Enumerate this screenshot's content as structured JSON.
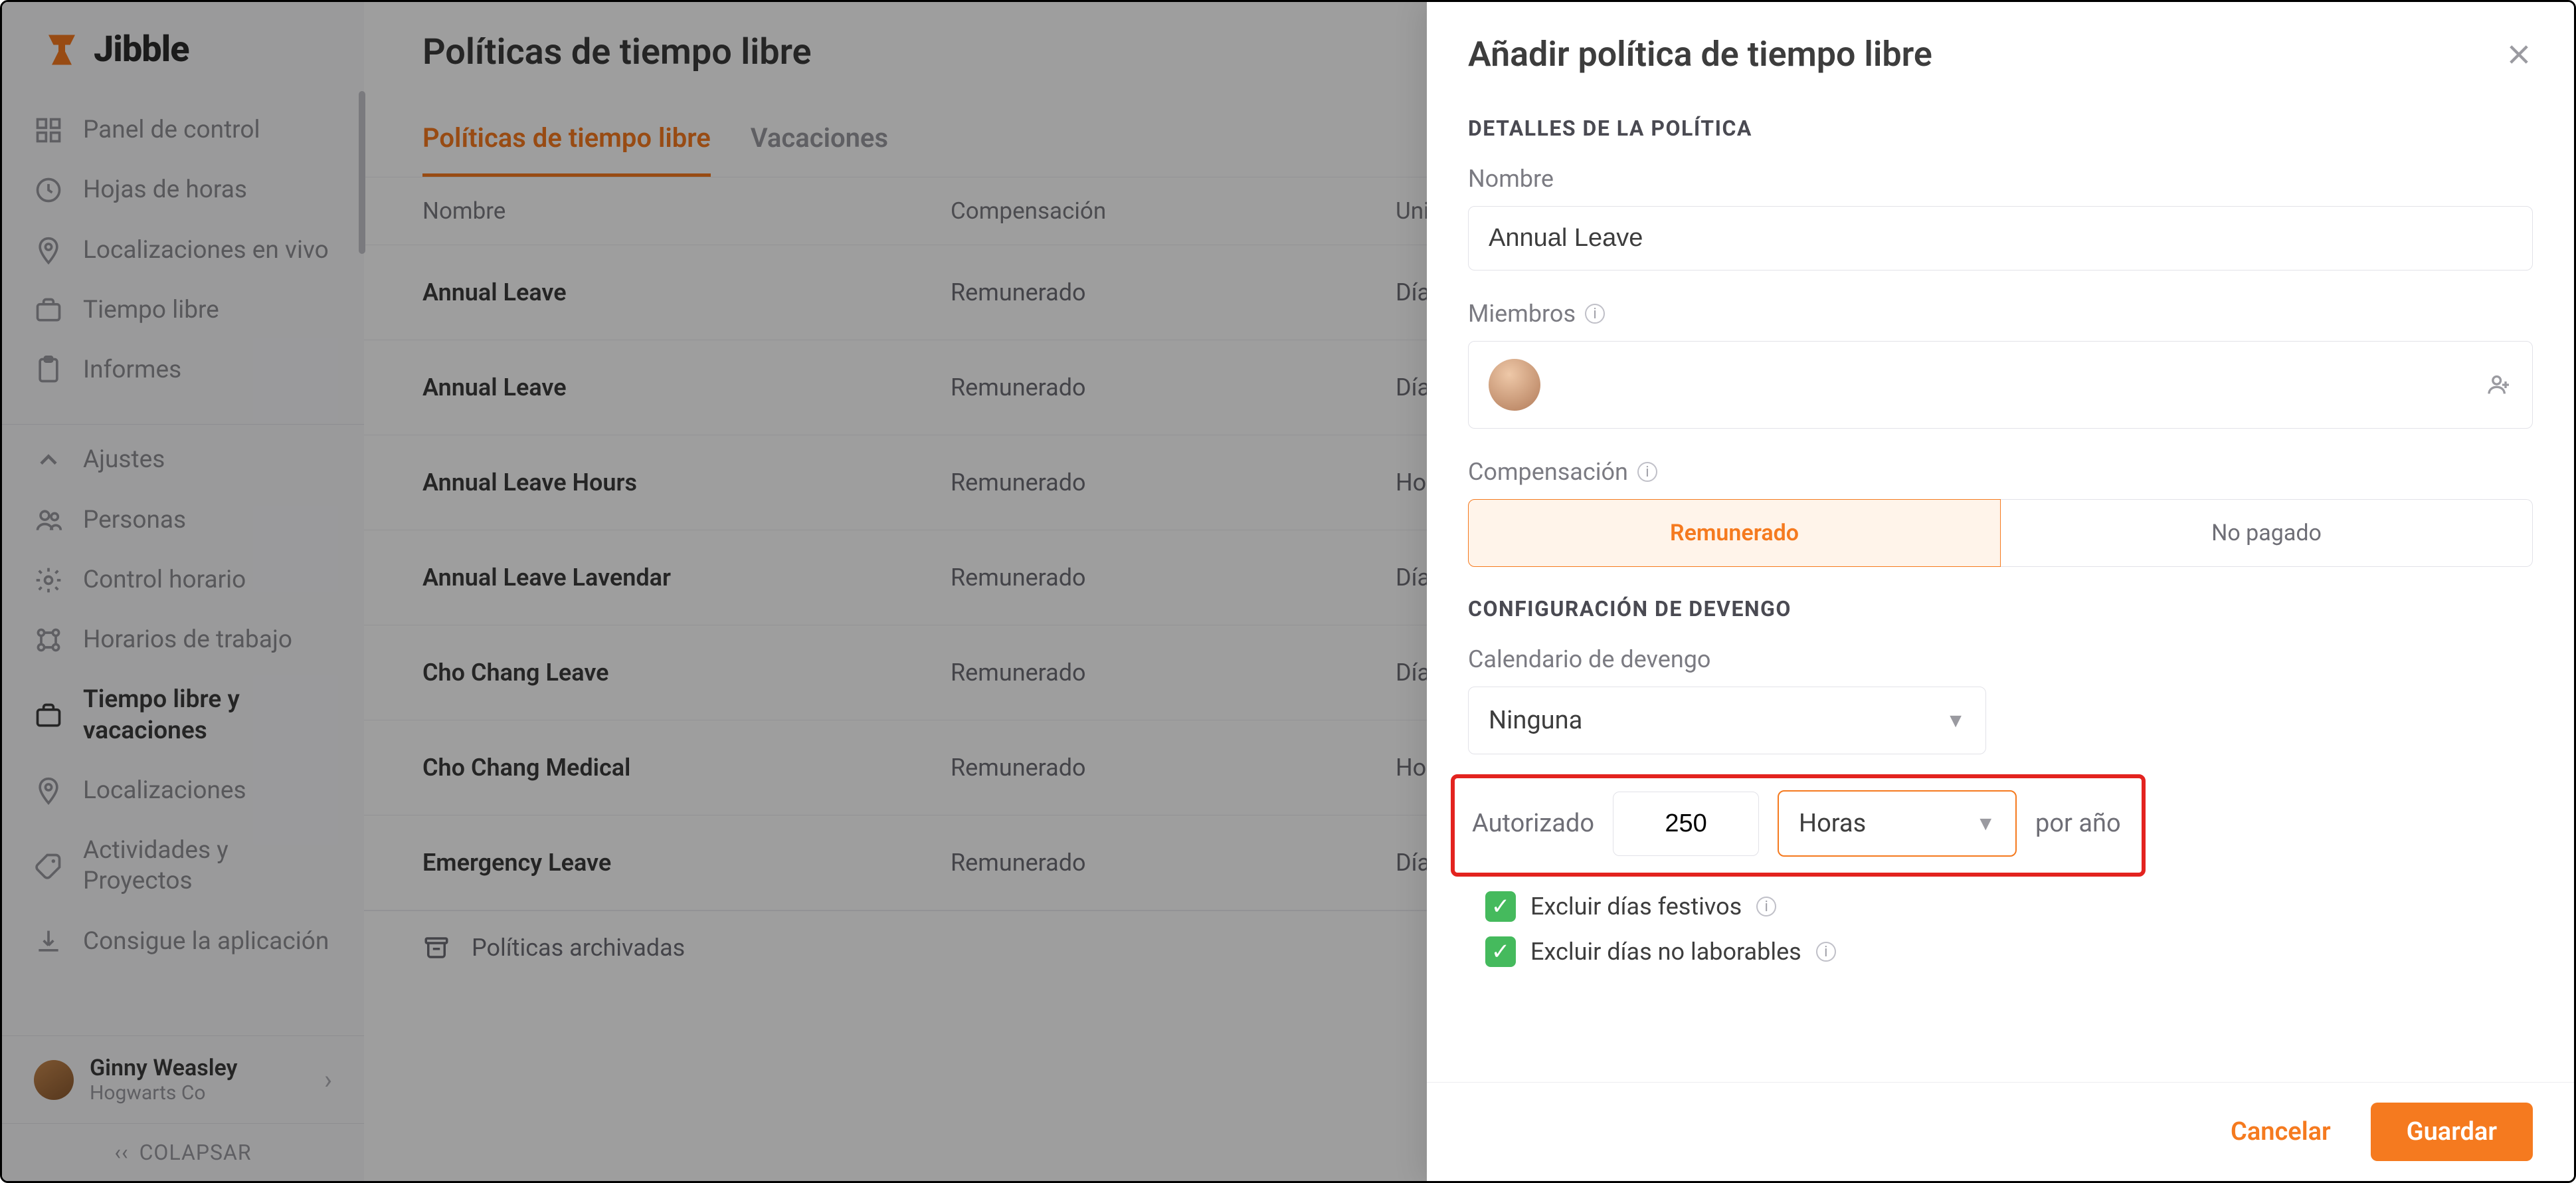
{
  "brand": {
    "name": "Jibble"
  },
  "sidebar": {
    "primary": [
      {
        "label": "Panel de control",
        "icon": "dashboard-icon"
      },
      {
        "label": "Hojas de horas",
        "icon": "timesheets-icon"
      },
      {
        "label": "Localizaciones en vivo",
        "icon": "location-icon"
      },
      {
        "label": "Tiempo libre",
        "icon": "briefcase-icon"
      },
      {
        "label": "Informes",
        "icon": "reports-icon"
      }
    ],
    "secondary": [
      {
        "label": "Ajustes",
        "icon": "chevron-up-icon"
      },
      {
        "label": "Personas",
        "icon": "people-icon"
      },
      {
        "label": "Control horario",
        "icon": "timetracking-icon"
      },
      {
        "label": "Horarios de trabajo",
        "icon": "schedules-icon"
      },
      {
        "label": "Tiempo libre y vacaciones",
        "icon": "briefcase-icon",
        "active": true
      },
      {
        "label": "Localizaciones",
        "icon": "location-icon"
      },
      {
        "label": "Actividades y Proyectos",
        "icon": "tag-icon"
      },
      {
        "label": "Consigue la aplicación",
        "icon": "download-icon"
      }
    ],
    "user": {
      "name": "Ginny Weasley",
      "org": "Hogwarts Co"
    },
    "collapse": "COLAPSAR"
  },
  "page": {
    "title": "Políticas de tiempo libre",
    "tabs": [
      {
        "label": "Políticas de tiempo libre",
        "active": true
      },
      {
        "label": "Vacaciones",
        "active": false
      }
    ],
    "columns": {
      "name": "Nombre",
      "comp": "Compensación",
      "unit": "Unidad"
    },
    "rows": [
      {
        "name": "Annual Leave",
        "comp": "Remunerado",
        "unit": "Días"
      },
      {
        "name": "Annual Leave",
        "comp": "Remunerado",
        "unit": "Días"
      },
      {
        "name": "Annual Leave Hours",
        "comp": "Remunerado",
        "unit": "Horas"
      },
      {
        "name": "Annual Leave Lavendar",
        "comp": "Remunerado",
        "unit": "Días"
      },
      {
        "name": "Cho Chang Leave",
        "comp": "Remunerado",
        "unit": "Días"
      },
      {
        "name": "Cho Chang Medical",
        "comp": "Remunerado",
        "unit": "Horas"
      },
      {
        "name": "Emergency Leave",
        "comp": "Remunerado",
        "unit": "Días"
      }
    ],
    "archived": "Políticas archivadas"
  },
  "drawer": {
    "title": "Añadir política de tiempo libre",
    "sections": {
      "details": "DETALLES DE LA POLÍTICA",
      "accrual": "CONFIGURACIÓN DE DEVENGO"
    },
    "fields": {
      "name_label": "Nombre",
      "name_value": "Annual Leave",
      "members_label": "Miembros",
      "comp_label": "Compensación",
      "comp_options": {
        "paid": "Remunerado",
        "unpaid": "No pagado"
      },
      "accrual_cal_label": "Calendario de devengo",
      "accrual_cal_value": "Ninguna",
      "entitled_label": "Autorizado",
      "entitled_value": "250",
      "entitled_unit": "Horas",
      "per_year": "por año",
      "exclude_holidays": "Excluir días festivos",
      "exclude_nonworking": "Excluir días no laborables"
    },
    "footer": {
      "cancel": "Cancelar",
      "save": "Guardar"
    }
  }
}
